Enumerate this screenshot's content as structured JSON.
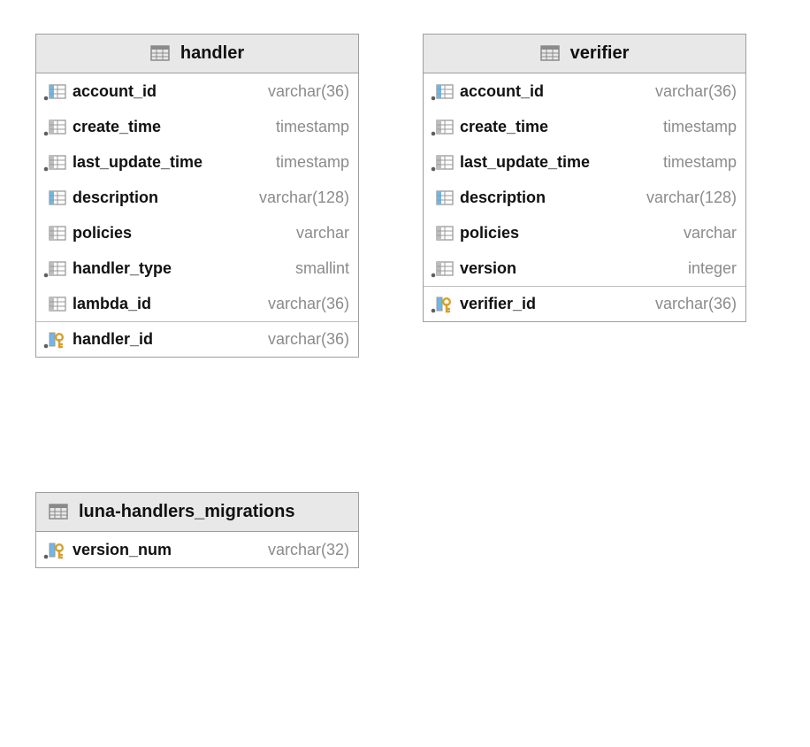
{
  "tables": {
    "handler": {
      "title": "handler",
      "columns": [
        {
          "name": "account_id",
          "type": "varchar(36)",
          "marker": "dot-blue-grid"
        },
        {
          "name": "create_time",
          "type": "timestamp",
          "marker": "dot-grey-grid"
        },
        {
          "name": "last_update_time",
          "type": "timestamp",
          "marker": "dot-grey-grid"
        },
        {
          "name": "description",
          "type": "varchar(128)",
          "marker": "blue-grid"
        },
        {
          "name": "policies",
          "type": "varchar",
          "marker": "grey-grid"
        },
        {
          "name": "handler_type",
          "type": "smallint",
          "marker": "dot-grey-grid"
        },
        {
          "name": "lambda_id",
          "type": "varchar(36)",
          "marker": "grey-grid"
        }
      ],
      "pk": {
        "name": "handler_id",
        "type": "varchar(36)",
        "marker": "dot-key"
      }
    },
    "verifier": {
      "title": "verifier",
      "columns": [
        {
          "name": "account_id",
          "type": "varchar(36)",
          "marker": "dot-blue-grid"
        },
        {
          "name": "create_time",
          "type": "timestamp",
          "marker": "dot-grey-grid"
        },
        {
          "name": "last_update_time",
          "type": "timestamp",
          "marker": "dot-grey-grid"
        },
        {
          "name": "description",
          "type": "varchar(128)",
          "marker": "blue-grid"
        },
        {
          "name": "policies",
          "type": "varchar",
          "marker": "grey-grid"
        },
        {
          "name": "version",
          "type": "integer",
          "marker": "dot-grey-grid"
        }
      ],
      "pk": {
        "name": "verifier_id",
        "type": "varchar(36)",
        "marker": "dot-key"
      }
    },
    "migrations": {
      "title": "luna-handlers_migrations",
      "columns": [],
      "pk": {
        "name": "version_num",
        "type": "varchar(32)",
        "marker": "dot-key"
      }
    }
  }
}
